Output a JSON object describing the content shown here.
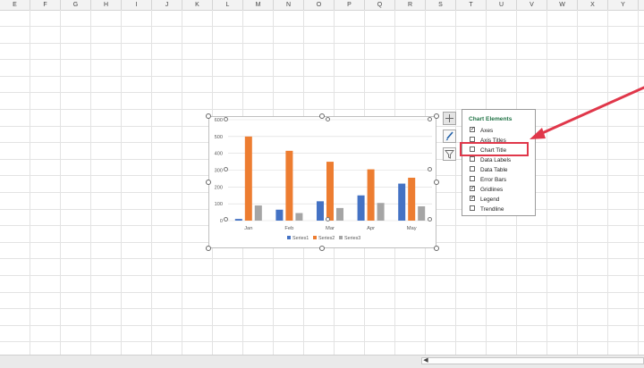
{
  "columns": [
    "E",
    "F",
    "G",
    "H",
    "I",
    "J",
    "K",
    "L",
    "M",
    "N",
    "O",
    "P",
    "Q",
    "R",
    "S",
    "T",
    "U",
    "V",
    "W",
    "X",
    "Y"
  ],
  "chart": {
    "type": "bar",
    "categories": [
      "Jan",
      "Feb",
      "Mar",
      "Apr",
      "May"
    ],
    "series": [
      {
        "name": "Series1",
        "values": [
          10,
          65,
          115,
          150,
          220
        ],
        "color": "#4472c4"
      },
      {
        "name": "Series2",
        "values": [
          500,
          415,
          350,
          305,
          255
        ],
        "color": "#ed7d31"
      },
      {
        "name": "Series3",
        "values": [
          90,
          45,
          75,
          105,
          85
        ],
        "color": "#a5a5a5"
      }
    ],
    "y_ticks": [
      "0",
      "100",
      "200",
      "300",
      "400",
      "500",
      "600"
    ],
    "ylim": [
      0,
      600
    ],
    "gridlines": true,
    "legend_position": "bottom"
  },
  "chart_elements": {
    "title": "Chart Elements",
    "items": [
      {
        "label": "Axes",
        "checked": true
      },
      {
        "label": "Axis Titles",
        "checked": false
      },
      {
        "label": "Chart Title",
        "checked": false
      },
      {
        "label": "Data Labels",
        "checked": false
      },
      {
        "label": "Data Table",
        "checked": false
      },
      {
        "label": "Error Bars",
        "checked": false
      },
      {
        "label": "Gridlines",
        "checked": true
      },
      {
        "label": "Legend",
        "checked": true
      },
      {
        "label": "Trendline",
        "checked": false
      }
    ]
  },
  "tool_buttons": {
    "elements_icon": "plus-icon",
    "styles_icon": "brush-icon",
    "filters_icon": "funnel-icon"
  },
  "highlight_color": "#e0374a",
  "accent_color": "#217346"
}
